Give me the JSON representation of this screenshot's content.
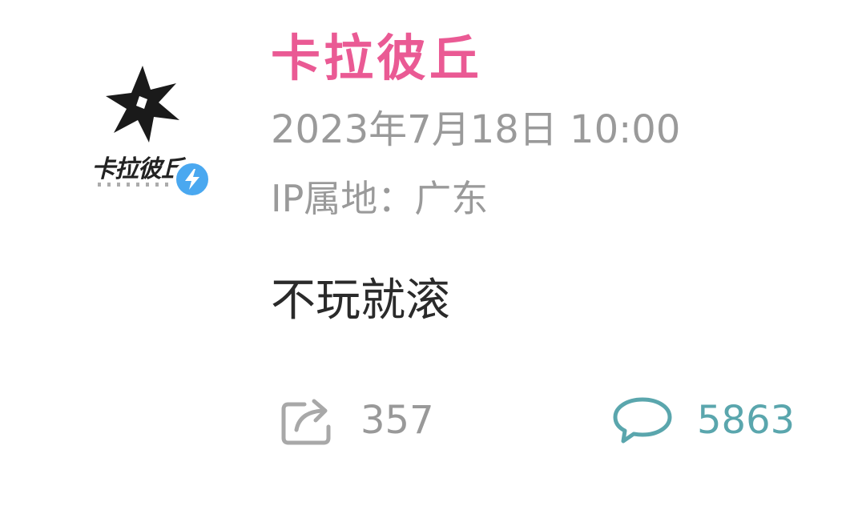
{
  "post": {
    "author": {
      "name": "卡拉彼丘",
      "avatar_text": "卡拉彼丘",
      "avatar_icon": "star-logo-icon",
      "verified_icon": "lightning-verified-icon"
    },
    "timestamp": "2023年7月18日 10:00",
    "ip_location": "IP属地：广东",
    "content": "不玩就滚",
    "actions": {
      "share": {
        "icon": "share-icon",
        "count": "357"
      },
      "comment": {
        "icon": "comment-icon",
        "count": "5863"
      }
    }
  },
  "colors": {
    "author_name": "#ea5a94",
    "meta_text": "#9a9a9a",
    "content_text": "#2a2a2a",
    "verified_badge": "#4aa8f0",
    "comment_accent": "#5aa6ad"
  }
}
